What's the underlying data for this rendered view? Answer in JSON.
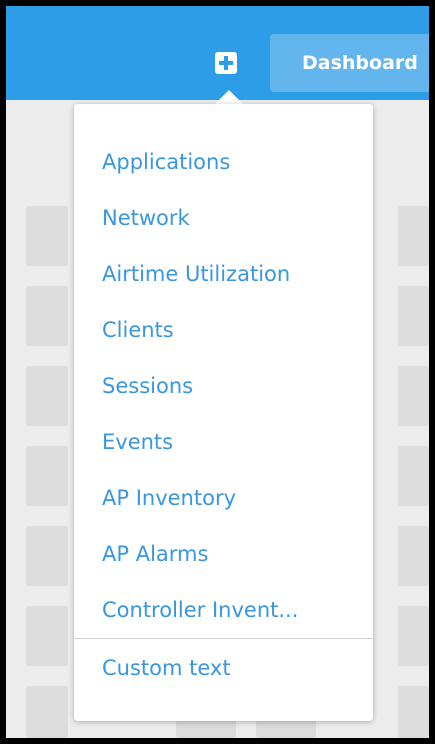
{
  "header": {
    "add_icon": "plus-square-icon",
    "dashboard_label": "Dashboard"
  },
  "menu": {
    "items": [
      {
        "label": "Applications"
      },
      {
        "label": "Network"
      },
      {
        "label": "Airtime Utilization"
      },
      {
        "label": "Clients"
      },
      {
        "label": "Sessions"
      },
      {
        "label": "Events"
      },
      {
        "label": "AP Inventory"
      },
      {
        "label": "AP Alarms"
      },
      {
        "label": "Controller Invent..."
      }
    ],
    "custom_label": "Custom text"
  },
  "colors": {
    "topbar": "#2e9de7",
    "menu_text": "#3a96df",
    "background": "#ececec"
  }
}
